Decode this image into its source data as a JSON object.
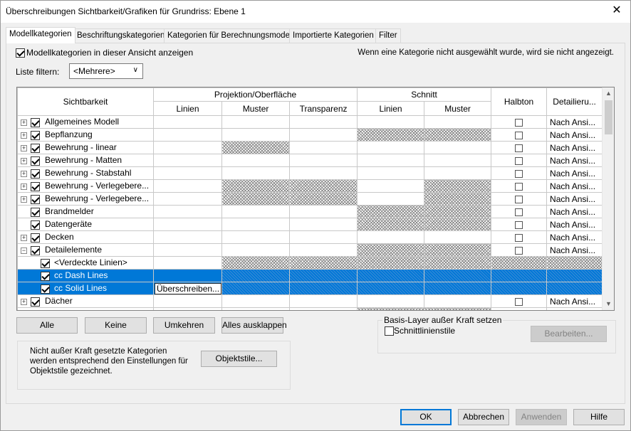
{
  "window": {
    "title": "Überschreibungen Sichtbarkeit/Grafiken für Grundriss: Ebene 1",
    "close": "✕"
  },
  "tabs": [
    "Modellkategorien",
    "Beschriftungskategorien",
    "Kategorien für Berechnungsmodell",
    "Importierte Kategorien",
    "Filter"
  ],
  "show_model_categories": {
    "label": "Modellkategorien in dieser Ansicht anzeigen",
    "checked": true
  },
  "hint": "Wenn eine Kategorie nicht ausgewählt wurde, wird sie nicht angezeigt.",
  "filter": {
    "label": "Liste filtern:",
    "value": "<Mehrere>"
  },
  "grid": {
    "headers": {
      "sichtbarkeit": "Sichtbarkeit",
      "projektion": "Projektion/Oberfläche",
      "schnitt": "Schnitt",
      "halbton": "Halbton",
      "detail": "Detailieru...",
      "linien": "Linien",
      "muster": "Muster",
      "transparenz": "Transparenz",
      "s_linien": "Linien",
      "s_muster": "Muster"
    },
    "rows": [
      {
        "name": "Allgemeines Modell",
        "expand": "+",
        "checked": true,
        "sub": false,
        "sel": false,
        "hatch": [
          false,
          false,
          false,
          false,
          false,
          false
        ],
        "halbton": true,
        "detail": "Nach Ansi..."
      },
      {
        "name": "Bepflanzung",
        "expand": "+",
        "checked": true,
        "sub": false,
        "sel": false,
        "hatch": [
          false,
          false,
          false,
          true,
          true,
          false
        ],
        "halbton": true,
        "detail": "Nach Ansi..."
      },
      {
        "name": "Bewehrung - linear",
        "expand": "+",
        "checked": true,
        "sub": false,
        "sel": false,
        "hatch": [
          false,
          true,
          false,
          false,
          false,
          false
        ],
        "halbton": true,
        "detail": "Nach Ansi..."
      },
      {
        "name": "Bewehrung - Matten",
        "expand": "+",
        "checked": true,
        "sub": false,
        "sel": false,
        "hatch": [
          false,
          false,
          false,
          false,
          false,
          false
        ],
        "halbton": true,
        "detail": "Nach Ansi..."
      },
      {
        "name": "Bewehrung - Stabstahl",
        "expand": "+",
        "checked": true,
        "sub": false,
        "sel": false,
        "hatch": [
          false,
          false,
          false,
          false,
          false,
          false
        ],
        "halbton": true,
        "detail": "Nach Ansi..."
      },
      {
        "name": "Bewehrung - Verlegebere...",
        "expand": "+",
        "checked": true,
        "sub": false,
        "sel": false,
        "hatch": [
          false,
          true,
          true,
          false,
          true,
          false
        ],
        "halbton": true,
        "detail": "Nach Ansi..."
      },
      {
        "name": "Bewehrung - Verlegebere...",
        "expand": "+",
        "checked": true,
        "sub": false,
        "sel": false,
        "hatch": [
          false,
          true,
          true,
          false,
          true,
          false
        ],
        "halbton": true,
        "detail": "Nach Ansi..."
      },
      {
        "name": "Brandmelder",
        "expand": "",
        "checked": true,
        "sub": false,
        "sel": false,
        "hatch": [
          false,
          false,
          false,
          true,
          true,
          false
        ],
        "halbton": true,
        "detail": "Nach Ansi..."
      },
      {
        "name": "Datengeräte",
        "expand": "",
        "checked": true,
        "sub": false,
        "sel": false,
        "hatch": [
          false,
          false,
          false,
          true,
          true,
          false
        ],
        "halbton": true,
        "detail": "Nach Ansi..."
      },
      {
        "name": "Decken",
        "expand": "+",
        "checked": true,
        "sub": false,
        "sel": false,
        "hatch": [
          false,
          false,
          false,
          false,
          false,
          false
        ],
        "halbton": true,
        "detail": "Nach Ansi..."
      },
      {
        "name": "Detailelemente",
        "expand": "−",
        "checked": true,
        "sub": false,
        "sel": false,
        "hatch": [
          false,
          false,
          false,
          true,
          true,
          false
        ],
        "halbton": true,
        "detail": "Nach Ansi..."
      },
      {
        "name": "<Verdeckte Linien>",
        "expand": "",
        "checked": true,
        "sub": true,
        "sel": false,
        "hatch": [
          false,
          true,
          true,
          true,
          true,
          true
        ],
        "halbton": false,
        "detail": ""
      },
      {
        "name": "cc Dash Lines",
        "expand": "",
        "checked": true,
        "sub": true,
        "sel": true,
        "hatch": [
          false,
          true,
          true,
          true,
          true,
          true
        ],
        "halbton": false,
        "detail": ""
      },
      {
        "name": "cc Solid Lines",
        "expand": "",
        "checked": true,
        "sub": true,
        "sel": true,
        "override": "Überschreiben...",
        "hatch": [
          false,
          true,
          true,
          true,
          true,
          true
        ],
        "halbton": false,
        "detail": ""
      },
      {
        "name": "Dächer",
        "expand": "+",
        "checked": true,
        "sub": false,
        "sel": false,
        "hatch": [
          false,
          false,
          false,
          false,
          false,
          false
        ],
        "halbton": true,
        "detail": "Nach Ansi..."
      },
      {
        "name": "",
        "expand": "+",
        "checked": true,
        "sub": false,
        "sel": false,
        "hatch": [
          false,
          false,
          false,
          true,
          true,
          false
        ],
        "halbton": true,
        "detail": ""
      }
    ]
  },
  "buttons": {
    "alle": "Alle",
    "keine": "Keine",
    "umkehren": "Umkehren",
    "ausklappen": "Alles ausklappen",
    "objektstile": "Objektstile...",
    "bearbeiten": "Bearbeiten...",
    "ok": "OK",
    "abbrechen": "Abbrechen",
    "anwenden": "Anwenden",
    "hilfe": "Hilfe"
  },
  "basis": {
    "legend": "Basis-Layer außer Kraft setzen",
    "schnitt_label": "Schnittlinienstile",
    "checked": false
  },
  "info": "Nicht außer Kraft gesetzte Kategorien werden entsprechend den Einstellungen für Objektstile gezeichnet."
}
